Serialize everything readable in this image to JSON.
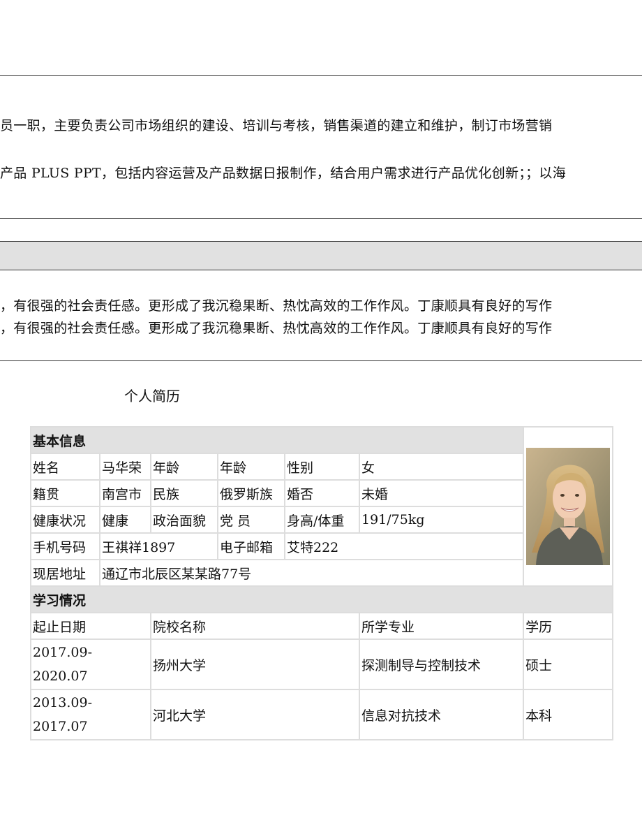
{
  "experience": {
    "line1": "员一职，主要负责公司市场组织的建设、培训与考核，销售渠道的建立和维护，制订市场营销",
    "line2": "产品 PLUS PPT，包括内容运营及产品数据日报制作，结合用户需求进行产品优化创新；；以海"
  },
  "evaluation": {
    "line1": "，有很强的社会责任感。更形成了我沉稳果断、热忱高效的工作作风。丁康顺具有良好的写作",
    "line2": "，有很强的社会责任感。更形成了我沉稳果断、热忱高效的工作作风。丁康顺具有良好的写作"
  },
  "resume": {
    "title": "个人简历",
    "basic_header": "基本信息",
    "name_label": "姓名",
    "name_value": "马华荣",
    "age_label": "年龄",
    "age_value": "年龄",
    "gender_label": "性别",
    "gender_value": "女",
    "origin_label": "籍贯",
    "origin_value": "南宫市",
    "ethnicity_label": "民族",
    "ethnicity_value": "俄罗斯族",
    "marital_label": "婚否",
    "marital_value": "未婚",
    "health_label": "健康状况",
    "health_value": "健康",
    "political_label": "政治面貌",
    "political_value": "党 员",
    "hw_label": "身高/体重",
    "hw_value": "191/75kg",
    "phone_label": "手机号码",
    "phone_value": "王祺祥1897",
    "email_label": "电子邮箱",
    "email_value": "艾特222",
    "address_label": "现居地址",
    "address_value": "通辽市北辰区某某路77号",
    "edu_header": "学习情况",
    "edu_columns": [
      "起止日期",
      "院校名称",
      "所学专业",
      "学历"
    ],
    "edu_rows": [
      {
        "period": "2017.09-2020.07",
        "school": "扬州大学",
        "major": "探测制导与控制技术",
        "degree": "硕士"
      },
      {
        "period": "2013.09-2017.07",
        "school": "河北大学",
        "major": "信息对抗技术",
        "degree": "本科"
      }
    ]
  },
  "colors": {
    "section_bg": "#e1e1e1",
    "cell_border": "#dddddd",
    "rule": "#333333"
  },
  "icons": {
    "photo": "portrait-photo"
  }
}
